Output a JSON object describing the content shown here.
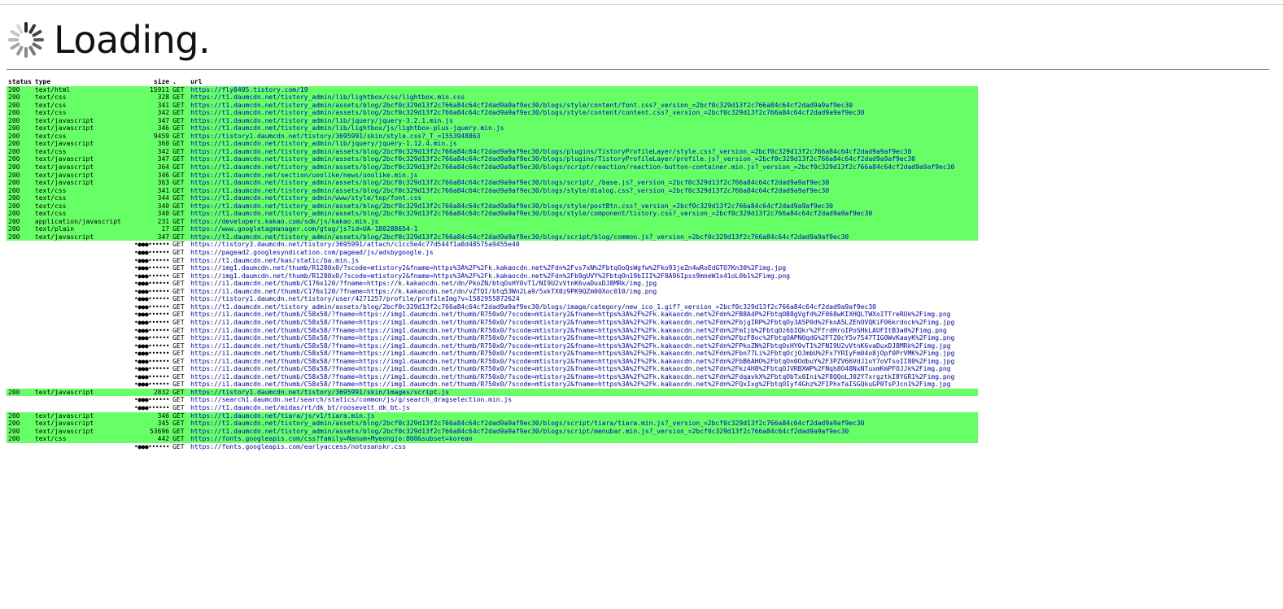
{
  "header": {
    "title": "Loading."
  },
  "columns": {
    "status": "status",
    "type": "type",
    "size": "size",
    "dot": ".",
    "url": "url"
  },
  "rows": [
    {
      "status": "200",
      "type": "text/html",
      "size": "15911",
      "method": "GET",
      "url": "https://fly8405.tistory.com/19",
      "ok": true
    },
    {
      "status": "200",
      "type": "text/css",
      "size": "328",
      "method": "GET",
      "url": "https://t1.daumcdn.net/tistory_admin/lib/lightbox/css/lightbox.min.css",
      "ok": true
    },
    {
      "status": "200",
      "type": "text/css",
      "size": "341",
      "method": "GET",
      "url": "https://t1.daumcdn.net/tistory_admin/assets/blog/2bcf0c329d13f2c766a84c64cf2dad9a9af9ec30/blogs/style/content/font.css?_version_=2bcf0c329d13f2c766a84c64cf2dad9a9af9ec30",
      "ok": true
    },
    {
      "status": "200",
      "type": "text/css",
      "size": "342",
      "method": "GET",
      "url": "https://t1.daumcdn.net/tistory_admin/assets/blog/2bcf0c329d13f2c766a84c64cf2dad9a9af9ec30/blogs/style/content/content.css?_version_=2bcf0c329d13f2c766a84c64cf2dad9a9af9ec30",
      "ok": true
    },
    {
      "status": "200",
      "type": "text/javascript",
      "size": "347",
      "method": "GET",
      "url": "https://t1.daumcdn.net/tistory_admin/lib/jquery/jquery-3.2.1.min.js",
      "ok": true
    },
    {
      "status": "200",
      "type": "text/javascript",
      "size": "346",
      "method": "GET",
      "url": "https://t1.daumcdn.net/tistory_admin/lib/lightbox/js/lightbox-plus-jquery.min.js",
      "ok": true
    },
    {
      "status": "200",
      "type": "text/css",
      "size": "9459",
      "method": "GET",
      "url": "https://tistory1.daumcdn.net/tistory/3695991/skin/style.css?_T_=1553948863",
      "ok": true
    },
    {
      "status": "200",
      "type": "text/javascript",
      "size": "360",
      "method": "GET",
      "url": "https://t1.daumcdn.net/tistory_admin/lib/jquery/jquery-1.12.4.min.js",
      "ok": true
    },
    {
      "status": "200",
      "type": "text/css",
      "size": "342",
      "method": "GET",
      "url": "https://t1.daumcdn.net/tistory_admin/assets/blog/2bcf0c329d13f2c766a84c64cf2dad9a9af9ec30/blogs/plugins/TistoryProfileLayer/style.css?_version_=2bcf0c329d13f2c766a84c64cf2dad9a9af9ec30",
      "ok": true
    },
    {
      "status": "200",
      "type": "text/javascript",
      "size": "347",
      "method": "GET",
      "url": "https://t1.daumcdn.net/tistory_admin/assets/blog/2bcf0c329d13f2c766a84c64cf2dad9a9af9ec30/blogs/plugins/TistoryProfileLayer/profile.js?_version_=2bcf0c329d13f2c766a84c64cf2dad9a9af9ec30",
      "ok": true
    },
    {
      "status": "200",
      "type": "text/javascript",
      "size": "364",
      "method": "GET",
      "url": "https://t1.daumcdn.net/tistory_admin/assets/blog/2bcf0c329d13f2c766a84c64cf2dad9a9af9ec30/blogs/script/reaction/reaction-button-container.min.js?_version_=2bcf0c329d13f2c766a84c64cf2dad9a9af9ec30",
      "ok": true
    },
    {
      "status": "200",
      "type": "text/javascript",
      "size": "346",
      "method": "GET",
      "url": "https://t1.daumcdn.net/section/uoolike/news/uoolike.min.js",
      "ok": true
    },
    {
      "status": "200",
      "type": "text/javascript",
      "size": "363",
      "method": "GET",
      "url": "https://t1.daumcdn.net/tistory_admin/assets/blog/2bcf0c329d13f2c766a84c64cf2dad9a9af9ec30/blogs/script/_/base.js?_version_=2bcf0c329d13f2c766a84c64cf2dad9a9af9ec30",
      "ok": true
    },
    {
      "status": "200",
      "type": "text/css",
      "size": "341",
      "method": "GET",
      "url": "https://t1.daumcdn.net/tistory_admin/assets/blog/2bcf0c329d13f2c766a84c64cf2dad9a9af9ec30/blogs/style/dialog.css?_version_=2bcf0c329d13f2c766a84c64cf2dad9a9af9ec30",
      "ok": true
    },
    {
      "status": "200",
      "type": "text/css",
      "size": "344",
      "method": "GET",
      "url": "https://t1.daumcdn.net/tistory_admin/www/style/top/font.css",
      "ok": true
    },
    {
      "status": "200",
      "type": "text/css",
      "size": "340",
      "method": "GET",
      "url": "https://t1.daumcdn.net/tistory_admin/assets/blog/2bcf0c329d13f2c766a84c64cf2dad9a9af9ec30/blogs/style/postBtn.css?_version_=2bcf0c329d13f2c766a84c64cf2dad9a9af9ec30",
      "ok": true
    },
    {
      "status": "200",
      "type": "text/css",
      "size": "340",
      "method": "GET",
      "url": "https://t1.daumcdn.net/tistory_admin/assets/blog/2bcf0c329d13f2c766a84c64cf2dad9a9af9ec30/blogs/style/component/tistory.css?_version_=2bcf0c329d13f2c766a84c64cf2dad9a9af9ec30",
      "ok": true
    },
    {
      "status": "200",
      "type": "application/javascript",
      "size": "231",
      "method": "GET",
      "url": "https://developers.kakao.com/sdk/js/kakao.min.js",
      "ok": true
    },
    {
      "status": "200",
      "type": "text/plain",
      "size": "17",
      "method": "GET",
      "url": "https://www.googletagmanager.com/gtag/js?id=UA-180288654-1",
      "ok": true
    },
    {
      "status": "200",
      "type": "text/javascript",
      "size": "347",
      "method": "GET",
      "url": "https://t1.daumcdn.net/tistory_admin/assets/blog/2bcf0c329d13f2c766a84c64cf2dad9a9af9ec30/blogs/script/blog/common.js?_version_=2bcf0c329d13f2c766a84c64cf2dad9a9af9ec30",
      "ok": true
    },
    {
      "status": "",
      "type": "",
      "size": "•●●●••••••",
      "method": "GET",
      "url": "https://tistory3.daumcdn.net/tistory/3695991/attach/c1cc5e4c77d544f1a8d48575a9455e40",
      "ok": false
    },
    {
      "status": "",
      "type": "",
      "size": "•●●●••••••",
      "method": "GET",
      "url": "https://pagead2.googlesyndication.com/pagead/js/adsbygoogle.js",
      "ok": false
    },
    {
      "status": "",
      "type": "",
      "size": "•●●●••••••",
      "method": "GET",
      "url": "https://t1.daumcdn.net/kas/static/ba.min.js",
      "ok": false
    },
    {
      "status": "",
      "type": "",
      "size": "•●●●••••••",
      "method": "GET",
      "url": "https://img1.daumcdn.net/thumb/R1280x0/?scode=mtistory2&fname=https%3A%2F%2Fk.kakaocdn.net%2Fdn%2Fvs7xN%2FbtqOoQsWgfw%2Fko93jeZn4wRoEdGTO7Kn30%2Fimg.jpg",
      "ok": false
    },
    {
      "status": "",
      "type": "",
      "size": "•●●●••••••",
      "method": "GET",
      "url": "https://img1.daumcdn.net/thumb/R1280x0/?scode=mtistory2&fname=https%3A%2F%2Fk.kakaocdn.net%2Fdn%2Fb9gUVY%2FbtqOn19bIII%2F8A96Ipss9mneW1x41oL0b1%2Fimg.png",
      "ok": false
    },
    {
      "status": "",
      "type": "",
      "size": "•●●●••••••",
      "method": "GET",
      "url": "https://i1.daumcdn.net/thumb/C176x120/?fname=https://k.kakaocdn.net/dn/PkoZN/btqOsHY0vT1/NI9U2vVtnK6vaDuxDJ8MRk/img.jpg",
      "ok": false
    },
    {
      "status": "",
      "type": "",
      "size": "•●●●••••••",
      "method": "GET",
      "url": "https://i1.daumcdn.net/thumb/C176x120/?fname=https://k.kakaocdn.net/dn/vZTQI/btq53Wn2La9/5xkTX0z9PK9QZm00Xoc010/img.png",
      "ok": false
    },
    {
      "status": "",
      "type": "",
      "size": "•●●●••••••",
      "method": "GET",
      "url": "https://tistory1.daumcdn.net/tistory/user/4271257/profile/profileImg?v=1582955872624",
      "ok": false
    },
    {
      "status": "",
      "type": "",
      "size": "•●●●••••••",
      "method": "GET",
      "url": "https://t1.daumcdn.net/tistory_admin/assets/blog/2bcf0c329d13f2c766a84c64cf2dad9a9af9ec30/blogs/image/category/new_ico_1.gif?_version_=2bcf0c329d13f2c766a84c64cf2dad9a9af9ec30",
      "ok": false
    },
    {
      "status": "",
      "type": "",
      "size": "•●●●••••••",
      "method": "GET",
      "url": "https://i1.daumcdn.net/thumb/C58x58/?fname=https://img1.daumcdn.net/thumb/R750x0/?scode=mtistory2&fname=https%3A%2F%2Fk.kakaocdn.net%2Fdn%2FB8A4P%2FbtqOB8gVgfd%2F868wKIXHQLTWXoITTreRUk%2Fimg.png",
      "ok": false
    },
    {
      "status": "",
      "type": "",
      "size": "•●●●••••••",
      "method": "GET",
      "url": "https://i1.daumcdn.net/thumb/C58x58/?fname=https://img1.daumcdn.net/thumb/R750x0/?scode=mtistory2&fname=https%3A%2F%2Fk.kakaocdn.net%2Fdn%2FbjgIRP%2FbtqOy3A5P0d%2FknA5LZEhOVQKiF06krdock%2Fimg.jpg",
      "ok": false
    },
    {
      "status": "",
      "type": "",
      "size": "•●●●••••••",
      "method": "GET",
      "url": "https://i1.daumcdn.net/thumb/C58x58/?fname=https://img1.daumcdn.net/thumb/R750x0/?scode=mtistory2&fname=https%3A%2F%2Fk.kakaocdn.net%2Fdn%2FmIjb%2FbtqOz6bIQkr%2FfrdHroIPoSHkLAUFItB3a0%2Fimg.png",
      "ok": false
    },
    {
      "status": "",
      "type": "",
      "size": "•●●●••••••",
      "method": "GET",
      "url": "https://i1.daumcdn.net/thumb/C58x58/?fname=https://img1.daumcdn.net/thumb/R750x0/?scode=mtistory2&fname=https%3A%2F%2Fk.kakaocdn.net%2Fdn%2FbzF8oc%2FbtqOAPN0qdG%2FTZ0cY5v7S47TIG0WvKaayK%2Fimg.png",
      "ok": false
    },
    {
      "status": "",
      "type": "",
      "size": "•●●●••••••",
      "method": "GET",
      "url": "https://i1.daumcdn.net/thumb/C58x58/?fname=https://img1.daumcdn.net/thumb/R750x0/?scode=mtistory2&fname=https%3A%2F%2Fk.kakaocdn.net%2Fdn%2FPkoZN%2FbtqOsHY0vT1%2FNI9U2vVtnK6vaDuxDJ8MRk%2Fimg.jpg",
      "ok": false
    },
    {
      "status": "",
      "type": "",
      "size": "•●●●••••••",
      "method": "GET",
      "url": "https://i1.daumcdn.net/thumb/C58x58/?fname=https://img1.daumcdn.net/thumb/R750x0/?scode=mtistory2&fname=https%3A%2F%2Fk.kakaocdn.net%2Fdn%2Fbn77Li%2FbtqOcjOJmbU%2Fx7YRIyFm04o8jOpf0PrVMK%2Fimg.jpg",
      "ok": false
    },
    {
      "status": "",
      "type": "",
      "size": "•●●●••••••",
      "method": "GET",
      "url": "https://i1.daumcdn.net/thumb/C58x58/?fname=https://img1.daumcdn.net/thumb/R750x0/?scode=mtistory2&fname=https%3A%2F%2Fk.kakaocdn.net%2Fdn%2FbB6AHO%2FbtqOn0OdbuY%2F3PZV66VdJ1oY7oVTsoII80%2Fimg.jpg",
      "ok": false
    },
    {
      "status": "",
      "type": "",
      "size": "•●●●••••••",
      "method": "GET",
      "url": "https://i1.daumcdn.net/thumb/C58x58/?fname=https://img1.daumcdn.net/thumb/R750x0/?scode=mtistory2&fname=https%3A%2F%2Fk.kakaocdn.net%2Fdn%2Fkz4H8%2FbtqOJVRBXWP%2FNqh8O48NxNTuxmKmPFOJJk%2Fimg.png",
      "ok": false
    },
    {
      "status": "",
      "type": "",
      "size": "•●●●••••••",
      "method": "GET",
      "url": "https://i1.daumcdn.net/thumb/C58x58/?fname=https://img1.daumcdn.net/thumb/R750x0/?scode=mtistory2&fname=https%3A%2F%2Fk.kakaocdn.net%2Fdn%2FdqavkX%2FbtqObTx0Ini%2F8QQoLJ02Y7xrgztkI8YGR1%2Fimg.png",
      "ok": false
    },
    {
      "status": "",
      "type": "",
      "size": "•●●●••••••",
      "method": "GET",
      "url": "https://i1.daumcdn.net/thumb/C58x58/?fname=https://img1.daumcdn.net/thumb/R750x0/?scode=mtistory2&fname=https%3A%2F%2Fk.kakaocdn.net%2Fdn%2FQxIxg%2FbtqOIyf4Ghz%2FIPhxfaISGQkuGP0TsPJcn1%2Fimg.jpg",
      "ok": false
    },
    {
      "status": "200",
      "type": "text/javascript",
      "size": "2832",
      "method": "GET",
      "url": "https://tistory1.daumcdn.net/tistory/3695991/skin/images/script.js",
      "ok": true
    },
    {
      "status": "",
      "type": "",
      "size": "•●●●••••••",
      "method": "GET",
      "url": "https://search1.daumcdn.net/search/statics/common/js/g/search_dragselection.min.js",
      "ok": false
    },
    {
      "status": "",
      "type": "",
      "size": "•●●●••••••",
      "method": "GET",
      "url": "https://t1.daumcdn.net/midas/rt/dk_bt/roosevelt_dk_bt.js",
      "ok": false
    },
    {
      "status": "200",
      "type": "text/javascript",
      "size": "346",
      "method": "GET",
      "url": "https://t1.daumcdn.net/tiara/js/v1/tiara.min.js",
      "ok": true
    },
    {
      "status": "200",
      "type": "text/javascript",
      "size": "345",
      "method": "GET",
      "url": "https://t1.daumcdn.net/tistory_admin/assets/blog/2bcf0c329d13f2c766a84c64cf2dad9a9af9ec30/blogs/script/tiara/tiara.min.js?_version_=2bcf0c329d13f2c766a84c64cf2dad9a9af9ec30",
      "ok": true
    },
    {
      "status": "200",
      "type": "text/javascript",
      "size": "53696",
      "method": "GET",
      "url": "https://t1.daumcdn.net/tistory_admin/assets/blog/2bcf0c329d13f2c766a84c64cf2dad9a9af9ec30/blogs/script/menubar.min.js?_version_=2bcf0c329d13f2c766a84c64cf2dad9a9af9ec30",
      "ok": true
    },
    {
      "status": "200",
      "type": "text/css",
      "size": "442",
      "method": "GET",
      "url": "https://fonts.googleapis.com/css?family=Nanum+Myeongjo:800&subset=korean",
      "ok": true
    },
    {
      "status": "",
      "type": "",
      "size": "•●●●••••••",
      "method": "GET",
      "url": "https://fonts.googleapis.com/earlyaccess/notosanskr.css",
      "ok": false
    }
  ],
  "colors": {
    "ok_row": "#66ff66",
    "url_text": "#0000c8",
    "spinner": "#2a2a2a"
  }
}
